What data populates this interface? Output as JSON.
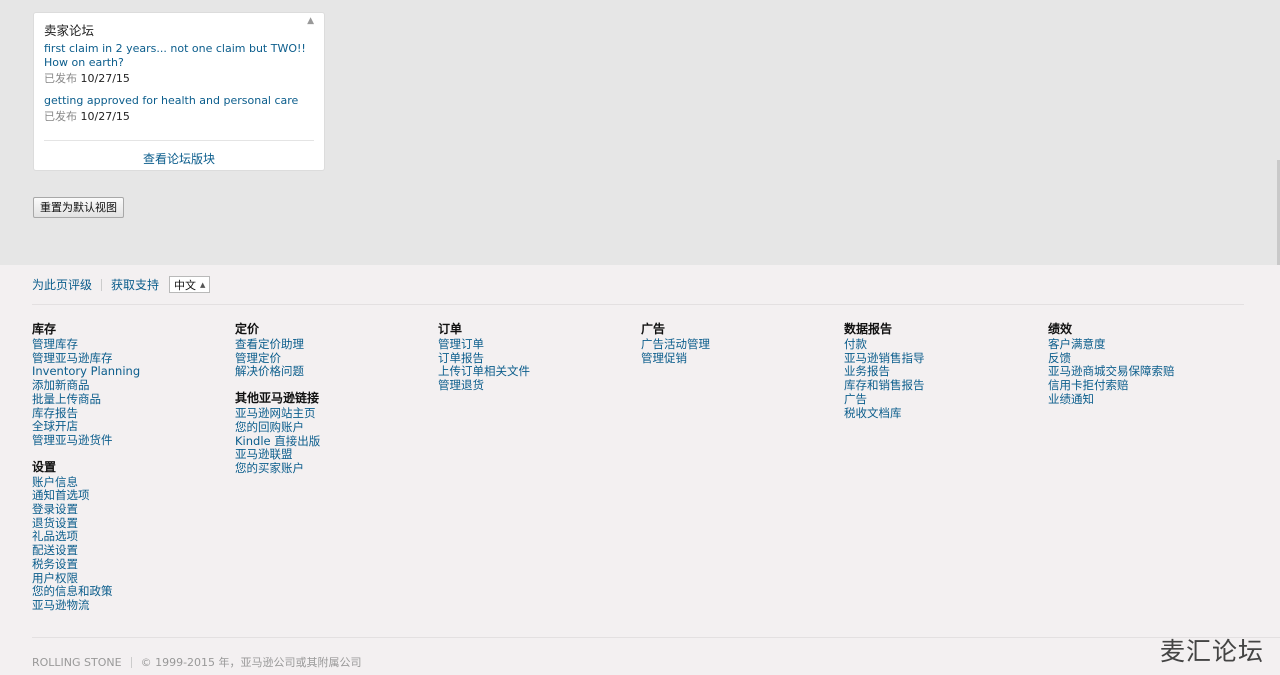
{
  "widget": {
    "title": "卖家论坛",
    "collapse_icon": "caret-up-icon",
    "posts": [
      {
        "title": "first claim in 2 years... not one claim but TWO!! How on earth?",
        "meta_label": "已发布",
        "date": "10/27/15"
      },
      {
        "title": "getting approved for health and personal care",
        "meta_label": "已发布",
        "date": "10/27/15"
      }
    ],
    "footer_link": "查看论坛版块"
  },
  "reset_button": "重置为默认视图",
  "footer": {
    "rate_page": "为此页评级",
    "get_support": "获取支持",
    "language": "中文",
    "columns": [
      {
        "groups": [
          {
            "title": "库存",
            "links": [
              "管理库存",
              "管理亚马逊库存",
              "Inventory Planning",
              "添加新商品",
              "批量上传商品",
              "库存报告",
              "全球开店",
              "管理亚马逊货件"
            ]
          },
          {
            "title": "设置",
            "links": [
              "账户信息",
              "通知首选项",
              "登录设置",
              "退货设置",
              "礼品选项",
              "配送设置",
              "税务设置",
              "用户权限",
              "您的信息和政策",
              "亚马逊物流"
            ]
          }
        ]
      },
      {
        "groups": [
          {
            "title": "定价",
            "links": [
              "查看定价助理",
              "管理定价",
              "解决价格问题"
            ]
          },
          {
            "title": "其他亚马逊链接",
            "links": [
              "亚马逊网站主页",
              "您的回购账户",
              "Kindle 直接出版",
              "亚马逊联盟",
              "您的买家账户"
            ]
          }
        ]
      },
      {
        "groups": [
          {
            "title": "订单",
            "links": [
              "管理订单",
              "订单报告",
              "上传订单相关文件",
              "管理退货"
            ]
          }
        ]
      },
      {
        "groups": [
          {
            "title": "广告",
            "links": [
              "广告活动管理",
              "管理促销"
            ]
          }
        ]
      },
      {
        "groups": [
          {
            "title": "数据报告",
            "links": [
              "付款",
              "亚马逊销售指导",
              "业务报告",
              "库存和销售报告",
              "广告",
              "税收文档库"
            ]
          }
        ]
      },
      {
        "groups": [
          {
            "title": "绩效",
            "links": [
              "客户满意度",
              "反馈",
              "亚马逊商城交易保障索赔",
              "信用卡拒付索赔",
              "业绩通知"
            ]
          }
        ]
      }
    ],
    "store_name": "ROLLING STONE",
    "copyright": "© 1999-2015 年，亚马逊公司或其附属公司"
  },
  "watermark": "麦汇论坛"
}
